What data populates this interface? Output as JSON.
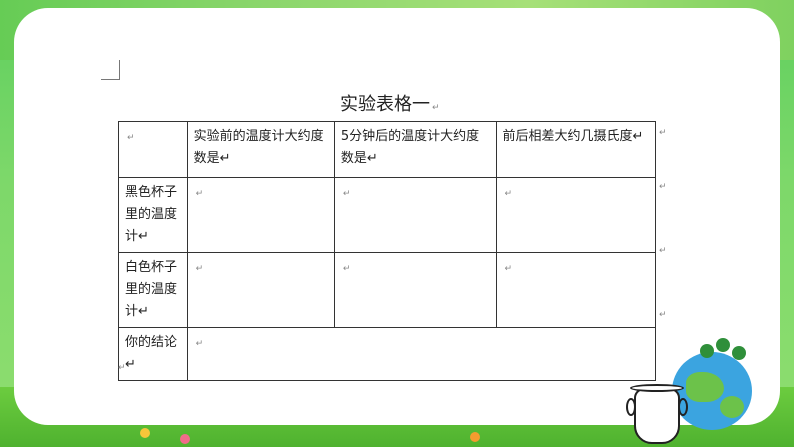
{
  "document": {
    "title": "实验表格一",
    "return_mark": "↵",
    "table": {
      "header": [
        "↵",
        "实验前的温度计大约度数是↵",
        "5分钟后的温度计大约度数是↵",
        "前后相差大约几摄氏度↵"
      ],
      "rows": [
        {
          "label": "黑色杯子里的温度计↵",
          "cells": [
            "↵",
            "↵",
            "↵"
          ]
        },
        {
          "label": "白色杯子里的温度计↵",
          "cells": [
            "↵",
            "↵",
            "↵"
          ]
        },
        {
          "label": "你的结论↵",
          "cells": [
            "↵"
          ]
        }
      ]
    }
  },
  "colors": {
    "background": "#6ccc55",
    "card": "#ffffff",
    "table_border": "#333333"
  },
  "icons": [
    "globe-with-trees-icon",
    "jar-icon"
  ]
}
